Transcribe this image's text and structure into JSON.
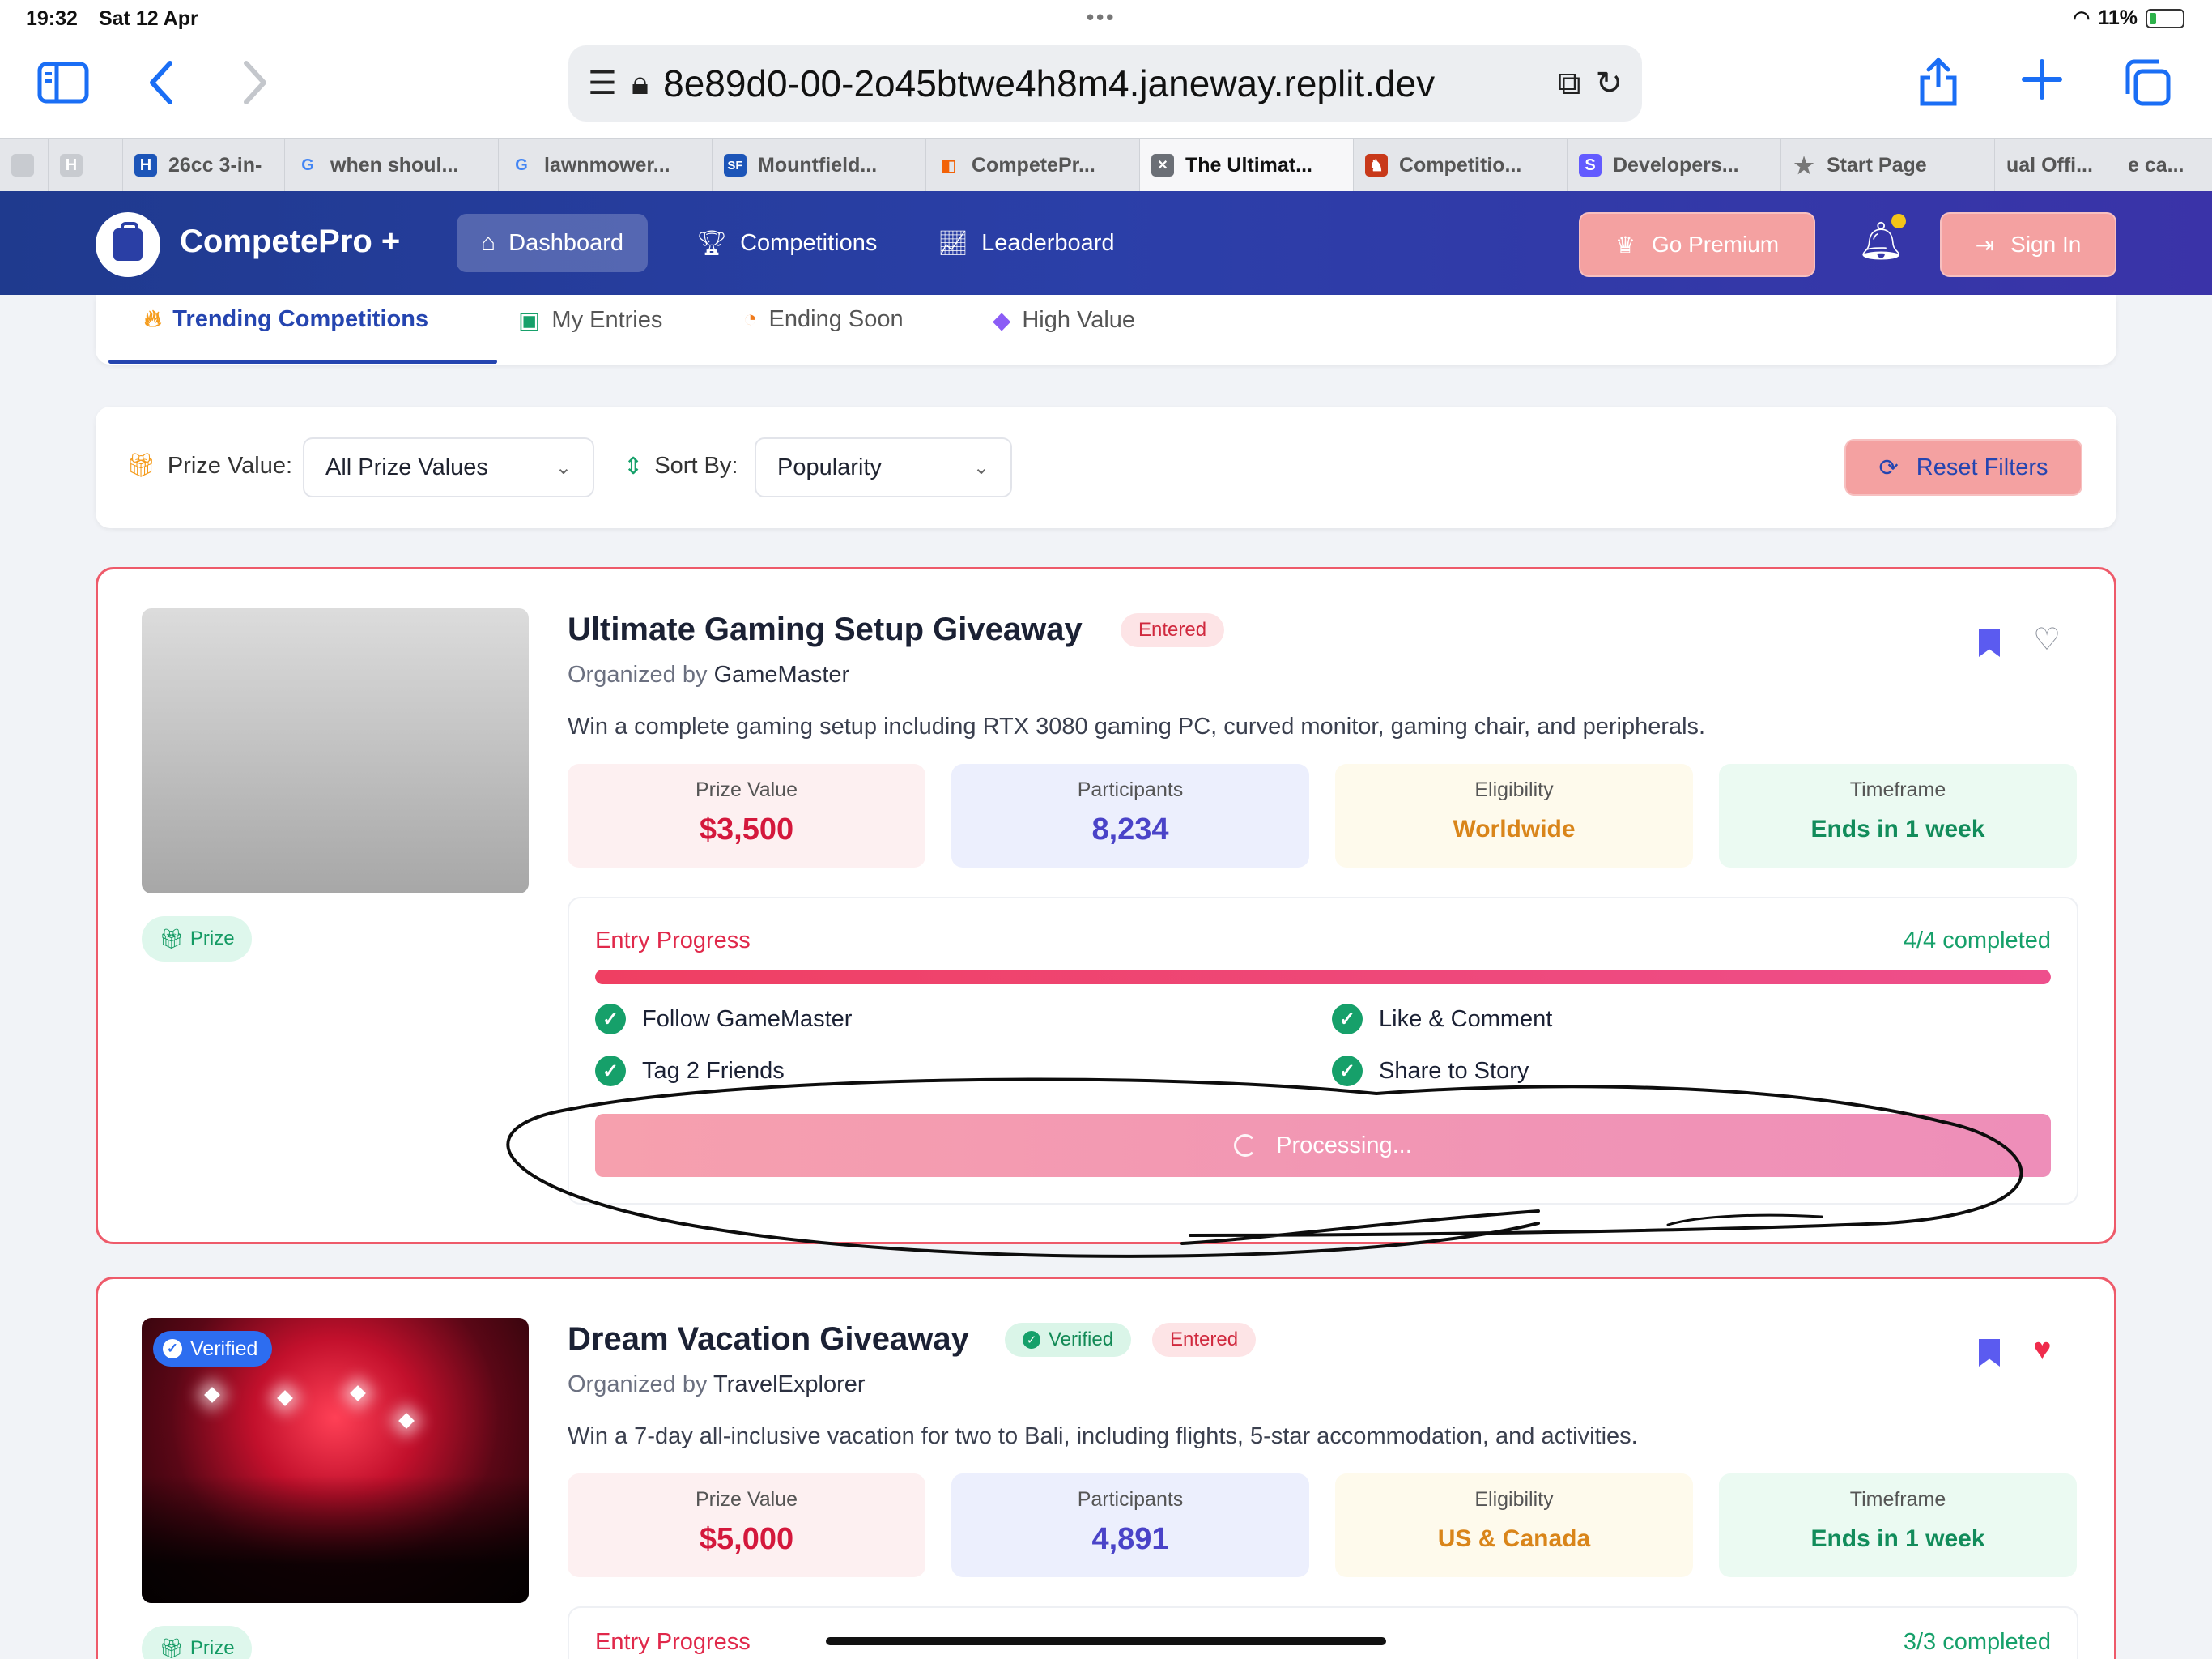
{
  "status_bar": {
    "time": "19:32",
    "date": "Sat 12 Apr",
    "battery": "11%"
  },
  "browser": {
    "url": "8e89d0-00-2o45btwe4h8m4.janeway.replit.dev",
    "tabs": [
      {
        "label": "",
        "icon": "blank-tab-icon"
      },
      {
        "label": "",
        "icon": "h-icon"
      },
      {
        "label": "26cc 3-in-",
        "icon": "h-brand-icon",
        "color": "#1c55b8"
      },
      {
        "label": "when shoul...",
        "icon": "google-icon"
      },
      {
        "label": "lawnmower...",
        "icon": "google-icon"
      },
      {
        "label": "Mountfield...",
        "icon": "sf-icon",
        "color": "#1c55b8"
      },
      {
        "label": "CompetePr...",
        "icon": "replit-icon",
        "color": "#f26207"
      },
      {
        "label": "The Ultimat...",
        "icon": "close-tab-icon",
        "active": true
      },
      {
        "label": "Competitio...",
        "icon": "game-icon",
        "color": "#c8391a"
      },
      {
        "label": "Developers...",
        "icon": "s-icon",
        "color": "#635bff"
      },
      {
        "label": "Start Page",
        "icon": "star-icon"
      },
      {
        "label": "ual Offi...",
        "icon": ""
      },
      {
        "label": "e ca...",
        "icon": ""
      }
    ]
  },
  "app": {
    "brand": "CompetePro +",
    "nav": {
      "dashboard": "Dashboard",
      "competitions": "Competitions",
      "leaderboard": "Leaderboard"
    },
    "premium": "Go Premium",
    "signin": "Sign In",
    "subtabs": {
      "trending": "Trending Competitions",
      "entries": "My Entries",
      "ending": "Ending Soon",
      "high": "High Value"
    },
    "filters": {
      "prize_label": "Prize Value:",
      "prize_value": "All Prize Values",
      "sort_label": "Sort By:",
      "sort_value": "Popularity",
      "reset": "Reset Filters"
    }
  },
  "competitions": [
    {
      "title": "Ultimate Gaming Setup Giveaway",
      "entered": "Entered",
      "organizer_prefix": "Organized by",
      "organizer": "GameMaster",
      "description": "Win a complete gaming setup including RTX 3080 gaming PC, curved monitor, gaming chair, and peripherals.",
      "prize_chip": "Prize",
      "stats": {
        "prize_label": "Prize Value",
        "prize": "$3,500",
        "participants_label": "Participants",
        "participants": "8,234",
        "eligibility_label": "Eligibility",
        "eligibility": "Worldwide",
        "timeframe_label": "Timeframe",
        "timeframe": "Ends in 1 week"
      },
      "progress_label": "Entry Progress",
      "progress_count": "4/4 completed",
      "progress_fraction": 1.0,
      "tasks": [
        "Follow GameMaster",
        "Like & Comment",
        "Tag 2 Friends",
        "Share to Story"
      ],
      "processing": "Processing..."
    },
    {
      "title": "Dream Vacation Giveaway",
      "verified": "Verified",
      "entered": "Entered",
      "image_badge": "Verified",
      "organizer_prefix": "Organized by",
      "organizer": "TravelExplorer",
      "description": "Win a 7-day all-inclusive vacation for two to Bali, including flights, 5-star accommodation, and activities.",
      "prize_chip": "Prize",
      "stats": {
        "prize_label": "Prize Value",
        "prize": "$5,000",
        "participants_label": "Participants",
        "participants": "4,891",
        "eligibility_label": "Eligibility",
        "eligibility": "US & Canada",
        "timeframe_label": "Timeframe",
        "timeframe": "Ends in 1 week"
      },
      "progress_label": "Entry Progress",
      "progress_count": "3/3 completed"
    }
  ]
}
